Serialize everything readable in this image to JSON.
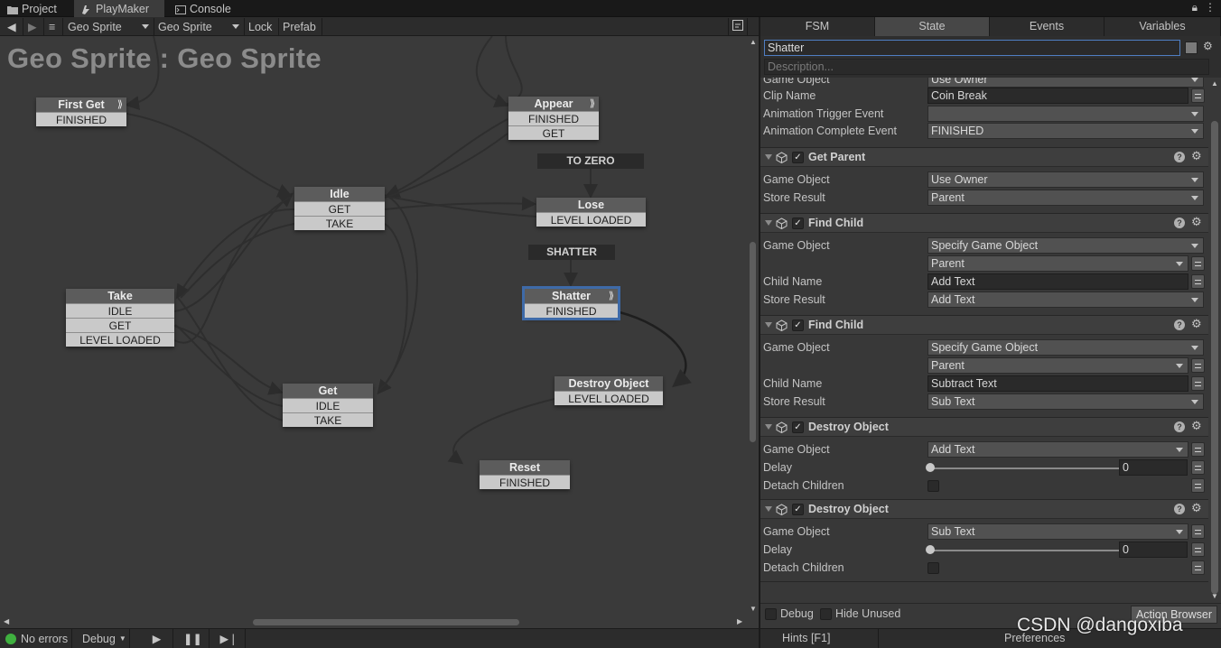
{
  "tabs": [
    {
      "label": "Project"
    },
    {
      "label": "PlayMaker"
    },
    {
      "label": "Console"
    }
  ],
  "toolbar": {
    "gameobject": "Geo Sprite",
    "fsm": "Geo Sprite",
    "lock": "Lock",
    "prefab": "Prefab"
  },
  "graph": {
    "title": "Geo Sprite : Geo Sprite",
    "states": {
      "first_get": {
        "name": "First Get",
        "events": [
          "FINISHED"
        ]
      },
      "appear": {
        "name": "Appear",
        "events": [
          "FINISHED",
          "GET"
        ]
      },
      "idle": {
        "name": "Idle",
        "events": [
          "GET",
          "TAKE"
        ]
      },
      "lose": {
        "name": "Lose",
        "events": [
          "LEVEL LOADED"
        ]
      },
      "take": {
        "name": "Take",
        "events": [
          "IDLE",
          "GET",
          "LEVEL LOADED"
        ]
      },
      "shatter": {
        "name": "Shatter",
        "events": [
          "FINISHED"
        ]
      },
      "get": {
        "name": "Get",
        "events": [
          "IDLE",
          "TAKE"
        ]
      },
      "destroy": {
        "name": "Destroy Object",
        "events": [
          "LEVEL LOADED"
        ]
      },
      "reset": {
        "name": "Reset",
        "events": [
          "FINISHED"
        ]
      }
    },
    "global_events": {
      "to_zero": "TO ZERO",
      "shatter": "SHATTER"
    }
  },
  "status": {
    "errors": "No errors",
    "debug": "Debug"
  },
  "inspector": {
    "tabs": [
      "FSM",
      "State",
      "Events",
      "Variables"
    ],
    "state_name": "Shatter",
    "description_placeholder": "Description...",
    "top_rows": [
      {
        "label": "Game Object",
        "value": "Use Owner"
      },
      {
        "label": "Clip Name",
        "value": "Coin Break"
      },
      {
        "label": "Animation Trigger Event",
        "value": ""
      },
      {
        "label": "Animation Complete Event",
        "value": "FINISHED"
      }
    ],
    "get_parent": {
      "title": "Get Parent",
      "game_object": {
        "label": "Game Object",
        "value": "Use Owner"
      },
      "store_result": {
        "label": "Store Result",
        "value": "Parent"
      }
    },
    "find_child_1": {
      "title": "Find Child",
      "game_object": {
        "label": "Game Object",
        "value": "Specify Game Object"
      },
      "game_object_var": "Parent",
      "child_name": {
        "label": "Child Name",
        "value": "Add Text"
      },
      "store_result": {
        "label": "Store Result",
        "value": "Add Text"
      }
    },
    "find_child_2": {
      "title": "Find Child",
      "game_object": {
        "label": "Game Object",
        "value": "Specify Game Object"
      },
      "game_object_var": "Parent",
      "child_name": {
        "label": "Child Name",
        "value": "Subtract Text"
      },
      "store_result": {
        "label": "Store Result",
        "value": "Sub Text"
      }
    },
    "destroy_1": {
      "title": "Destroy Object",
      "game_object": {
        "label": "Game Object",
        "value": "Add Text"
      },
      "delay": {
        "label": "Delay",
        "value": "0"
      },
      "detach": {
        "label": "Detach Children"
      }
    },
    "destroy_2": {
      "title": "Destroy Object",
      "game_object": {
        "label": "Game Object",
        "value": "Sub Text"
      },
      "delay": {
        "label": "Delay",
        "value": "0"
      },
      "detach": {
        "label": "Detach Children"
      }
    },
    "footer": {
      "debug": "Debug",
      "hide_unused": "Hide Unused",
      "action_browser": "Action Browser",
      "hints": "Hints [F1]",
      "preferences": "Preferences"
    }
  },
  "watermark": "CSDN @dangoxiba"
}
